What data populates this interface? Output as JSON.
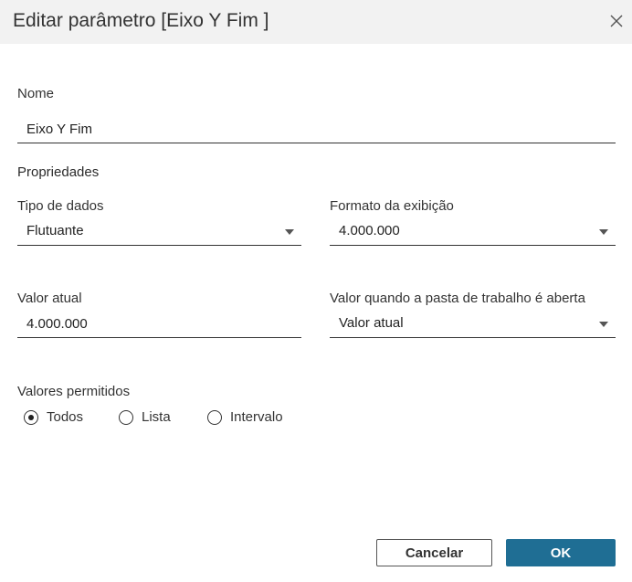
{
  "dialog": {
    "title": "Editar parâmetro [Eixo Y Fim ]",
    "close_icon": "close-icon"
  },
  "name_section": {
    "label": "Nome",
    "value": "Eixo Y Fim"
  },
  "properties": {
    "label": "Propriedades",
    "data_type": {
      "label": "Tipo de dados",
      "value": "Flutuante"
    },
    "display_format": {
      "label": "Formato da exibição",
      "value": "4.000.000"
    },
    "current_value": {
      "label": "Valor atual",
      "value": "4.000.000"
    },
    "value_on_open": {
      "label": "Valor quando a pasta de trabalho é aberta",
      "value": "Valor atual"
    }
  },
  "allowed_values": {
    "label": "Valores permitidos",
    "options": [
      {
        "label": "Todos",
        "selected": true
      },
      {
        "label": "Lista",
        "selected": false
      },
      {
        "label": "Intervalo",
        "selected": false
      }
    ]
  },
  "buttons": {
    "cancel": "Cancelar",
    "ok": "OK"
  },
  "colors": {
    "title_bar_bg": "#f2f2f2",
    "primary_button": "#1f6e94"
  }
}
